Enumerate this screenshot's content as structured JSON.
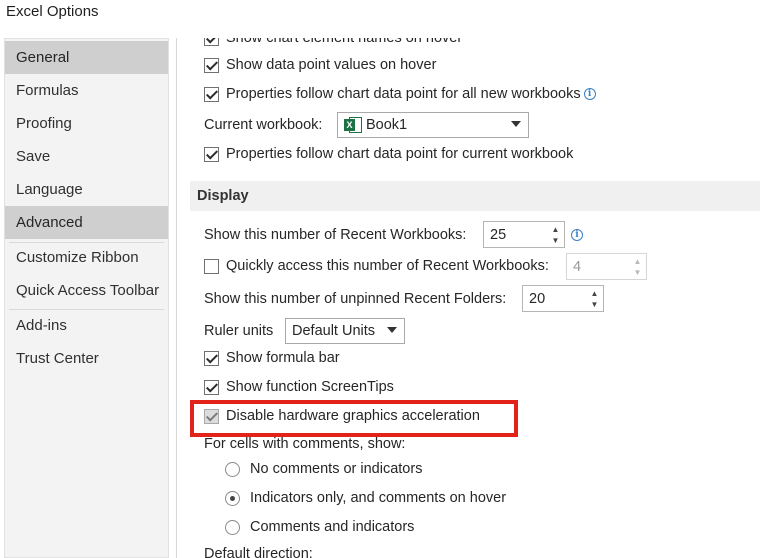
{
  "window": {
    "title": "Excel Options"
  },
  "sidebar": {
    "items": [
      {
        "label": "General",
        "selected": true
      },
      {
        "label": "Formulas",
        "selected": false
      },
      {
        "label": "Proofing",
        "selected": false
      },
      {
        "label": "Save",
        "selected": false
      },
      {
        "label": "Language",
        "selected": false
      },
      {
        "label": "Advanced",
        "selected": true
      },
      {
        "label": "Customize Ribbon",
        "selected": false
      },
      {
        "label": "Quick Access Toolbar",
        "selected": false
      },
      {
        "label": "Add-ins",
        "selected": false
      },
      {
        "label": "Trust Center",
        "selected": false
      }
    ]
  },
  "chart_section": {
    "partial_label": "Show chart element names on hover",
    "show_values_label": "Show data point values on hover",
    "props_all_label": "Properties follow chart data point for all new workbooks",
    "current_workbook_label": "Current workbook:",
    "current_workbook_value": "Book1",
    "props_current_label": "Properties follow chart data point for current workbook"
  },
  "display_section": {
    "header": "Display",
    "recent_workbooks_label": "Show this number of Recent Workbooks:",
    "recent_workbooks_value": "25",
    "quick_access_label": "Quickly access this number of Recent Workbooks:",
    "quick_access_value": "4",
    "unpinned_folders_label": "Show this number of unpinned Recent Folders:",
    "unpinned_folders_value": "20",
    "ruler_units_label": "Ruler units",
    "ruler_units_value": "Default Units",
    "formula_bar_label": "Show formula bar",
    "screentips_label": "Show function ScreenTips",
    "hardware_accel_label": "Disable hardware graphics acceleration",
    "comments_label": "For cells with comments, show:",
    "radio_none": "No comments or indicators",
    "radio_indicators": "Indicators only, and comments on hover",
    "radio_both": "Comments and indicators",
    "default_direction_label": "Default direction:"
  },
  "colors": {
    "highlight": "#e2231a",
    "excel_green": "#1e7145",
    "info_blue": "#3a7fc4"
  }
}
